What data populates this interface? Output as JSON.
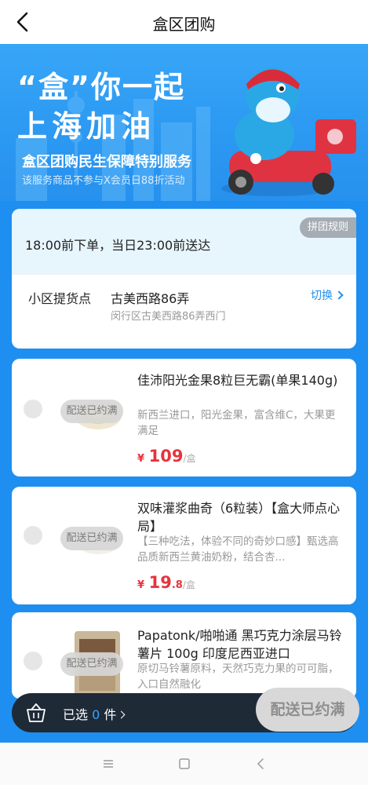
{
  "header": {
    "title": "盒区团购"
  },
  "banner": {
    "title_line1": "“盒”你一起",
    "title_line2": "上海加油",
    "subtitle": "盒区团购民生保障特别服务",
    "note": "该服务商品不参与X会员日88折活动"
  },
  "info": {
    "rule_tag": "拼团规则",
    "delivery_text": "18:00前下单，当日23:00前送达",
    "pickup_label": "小区提货点",
    "pickup_name": "古美西路86弄",
    "pickup_address": "闵行区古美西路86弄西门",
    "switch_label": "切换"
  },
  "products": [
    {
      "title": "佳沛阳光金果8粒巨无霸(单果140g)",
      "desc": "新西兰进口，阳光金果，富含维C，大果更满足",
      "price_int": "109",
      "price_dec": "",
      "unit": "/盒",
      "status": "配送已约满"
    },
    {
      "title": "双味灌浆曲奇（6粒装）【盒大师点心局】",
      "desc": "【三种吃法，体验不同的奇妙口感】甄选高品质新西兰黄油奶粉，结合杏...",
      "price_int": "19",
      "price_dec": ".8",
      "unit": "/盒",
      "status": "配送已约满"
    },
    {
      "title": "Papatonk/啪啪通 黑巧克力涂层马铃薯片 100g 印度尼西亚进口",
      "desc": "原切马铃薯原料，天然巧克力果的可可脂，入口自然融化",
      "status": "配送已约满"
    }
  ],
  "currency_symbol": "¥",
  "cart": {
    "selected_prefix": "已选",
    "selected_count": "0",
    "selected_suffix": "件",
    "checkout_label": "配送已约满"
  },
  "colors": {
    "accent": "#1e8ff0",
    "price": "#e8333c",
    "cart_bar": "#1f2a37"
  }
}
